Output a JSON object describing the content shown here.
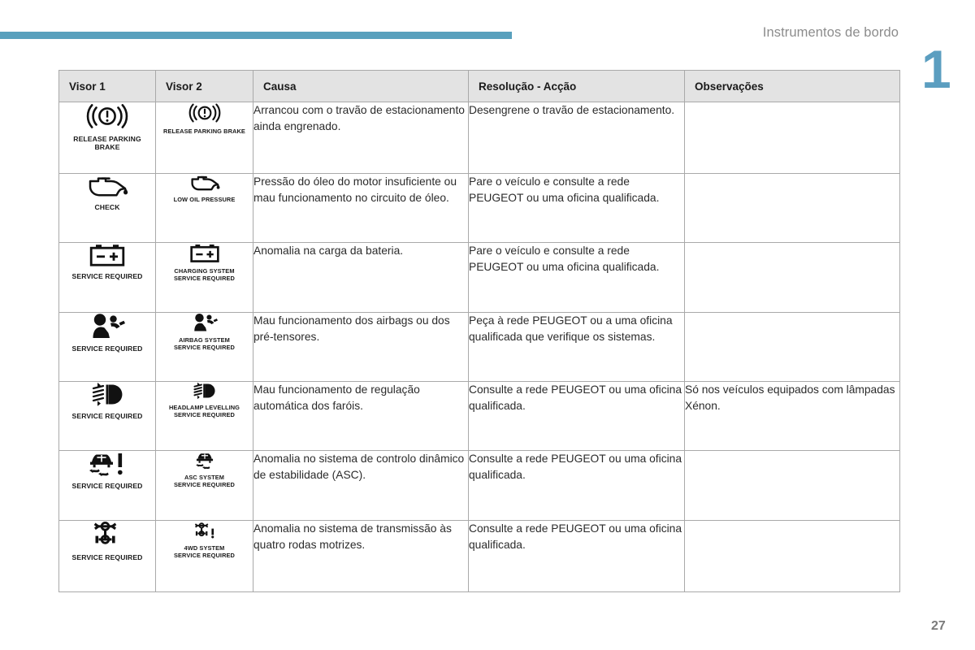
{
  "header": {
    "title": "Instrumentos de bordo",
    "chapter": "1",
    "accent_color": "#59a0bd"
  },
  "footer": {
    "page_number": "27"
  },
  "table": {
    "columns": [
      {
        "key": "visor1",
        "label": "Visor 1"
      },
      {
        "key": "visor2",
        "label": "Visor 2"
      },
      {
        "key": "causa",
        "label": "Causa"
      },
      {
        "key": "resolucao",
        "label": "Resolução - Acção"
      },
      {
        "key": "observacoes",
        "label": "Observações"
      }
    ],
    "rows": [
      {
        "visor1": {
          "icon": "release-parking-brake-icon",
          "caption": "RELEASE PARKING\nBRAKE"
        },
        "visor2": {
          "icon": "release-parking-brake-icon",
          "caption": "RELEASE PARKING BRAKE"
        },
        "causa": "Arrancou com o travão de estacionamento ainda engrenado.",
        "resolucao": "Desengrene o travão de estacionamento.",
        "observacoes": ""
      },
      {
        "visor1": {
          "icon": "oil-can-icon",
          "caption": "CHECK"
        },
        "visor2": {
          "icon": "oil-can-icon",
          "caption": "LOW OIL PRESSURE"
        },
        "causa": "Pressão do óleo do motor insuficiente ou mau funcionamento no circuito de óleo.",
        "resolucao": "Pare o veículo e consulte a rede PEUGEOT ou uma oficina qualificada.",
        "observacoes": ""
      },
      {
        "visor1": {
          "icon": "battery-icon",
          "caption": "SERVICE REQUIRED"
        },
        "visor2": {
          "icon": "battery-icon",
          "caption": "CHARGING SYSTEM\nSERVICE REQUIRED"
        },
        "causa": "Anomalia na carga da bateria.",
        "resolucao": "Pare o veículo e consulte a rede PEUGEOT ou uma oficina qualificada.",
        "observacoes": ""
      },
      {
        "visor1": {
          "icon": "airbag-icon",
          "caption": "SERVICE REQUIRED"
        },
        "visor2": {
          "icon": "airbag-icon",
          "caption": "AIRBAG SYSTEM\nSERVICE REQUIRED"
        },
        "causa": "Mau funcionamento dos airbags ou dos pré-tensores.",
        "resolucao": "Peça à rede PEUGEOT ou a uma oficina qualificada que verifique os sistemas.",
        "observacoes": ""
      },
      {
        "visor1": {
          "icon": "headlamp-levelling-icon",
          "caption": "SERVICE REQUIRED"
        },
        "visor2": {
          "icon": "headlamp-levelling-icon",
          "caption": "HEADLAMP LEVELLING\nSERVICE REQUIRED"
        },
        "causa": "Mau funcionamento de regulação automática dos faróis.",
        "resolucao": "Consulte a rede PEUGEOT ou uma oficina qualificada.",
        "observacoes": "Só nos veículos equipados com lâmpadas Xénon."
      },
      {
        "visor1": {
          "icon": "asc-stability-icon",
          "caption": "SERVICE REQUIRED"
        },
        "visor2": {
          "icon": "asc-stability-icon",
          "caption": "ASC SYSTEM\nSERVICE REQUIRED"
        },
        "causa": "Anomalia no sistema de controlo dinâmico de estabilidade (ASC).",
        "resolucao": "Consulte a rede PEUGEOT ou uma oficina qualificada.",
        "observacoes": ""
      },
      {
        "visor1": {
          "icon": "four-wheel-drive-icon",
          "caption": "SERVICE REQUIRED"
        },
        "visor2": {
          "icon": "four-wheel-drive-icon",
          "caption": "4WD SYSTEM\nSERVICE REQUIRED"
        },
        "causa": "Anomalia no sistema de transmissão às quatro rodas motrizes.",
        "resolucao": "Consulte a rede PEUGEOT ou uma oficina qualificada.",
        "observacoes": ""
      }
    ]
  }
}
